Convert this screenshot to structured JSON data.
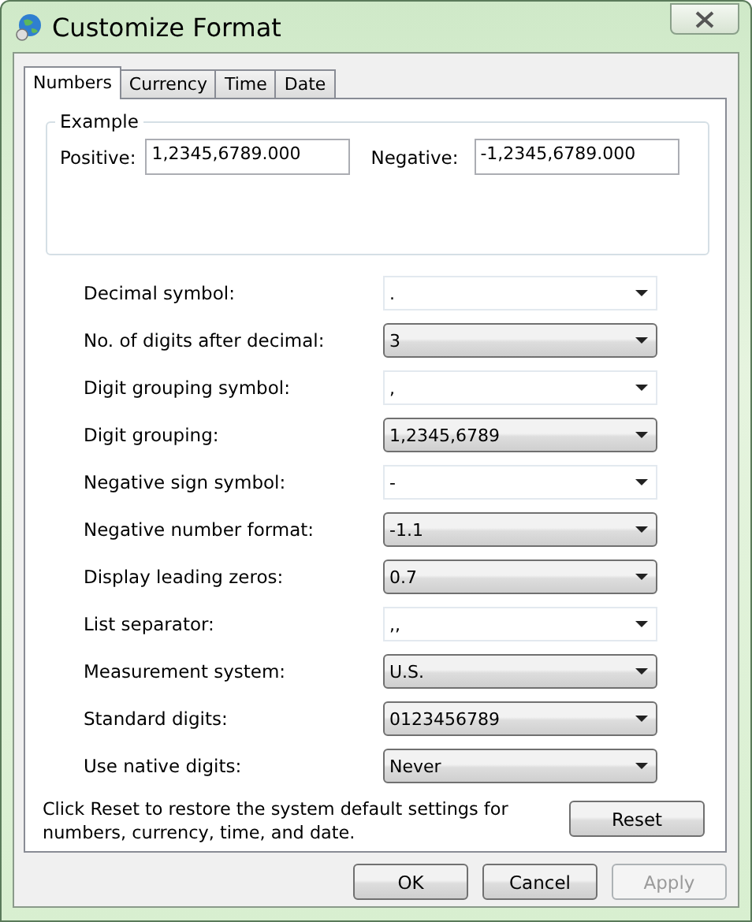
{
  "window": {
    "title": "Customize Format"
  },
  "tabs": [
    {
      "label": "Numbers",
      "selected": true
    },
    {
      "label": "Currency",
      "selected": false
    },
    {
      "label": "Time",
      "selected": false
    },
    {
      "label": "Date",
      "selected": false
    }
  ],
  "example": {
    "legend": "Example",
    "positive_label": "Positive:",
    "positive_value": "1,2345,6789.000",
    "negative_label": "Negative:",
    "negative_value": "-1,2345,6789.000"
  },
  "settings": [
    {
      "label": "Decimal symbol:",
      "value": ".",
      "kind": "editable"
    },
    {
      "label": "No. of digits after decimal:",
      "value": "3",
      "kind": "list"
    },
    {
      "label": "Digit grouping symbol:",
      "value": ",",
      "kind": "editable"
    },
    {
      "label": "Digit grouping:",
      "value": "1,2345,6789",
      "kind": "list"
    },
    {
      "label": "Negative sign symbol:",
      "value": "-",
      "kind": "editable"
    },
    {
      "label": "Negative number format:",
      "value": "-1.1",
      "kind": "list"
    },
    {
      "label": "Display leading zeros:",
      "value": "0.7",
      "kind": "list"
    },
    {
      "label": "List separator:",
      "value": ",,",
      "kind": "editable"
    },
    {
      "label": "Measurement system:",
      "value": "U.S.",
      "kind": "list"
    },
    {
      "label": "Standard digits:",
      "value": "0123456789",
      "kind": "list"
    },
    {
      "label": "Use native digits:",
      "value": "Never",
      "kind": "list"
    }
  ],
  "reset": {
    "note": "Click Reset to restore the system default settings for numbers, currency, time, and date.",
    "button": "Reset"
  },
  "buttons": [
    {
      "label": "OK",
      "disabled": false
    },
    {
      "label": "Cancel",
      "disabled": false
    },
    {
      "label": "Apply",
      "disabled": true
    }
  ]
}
